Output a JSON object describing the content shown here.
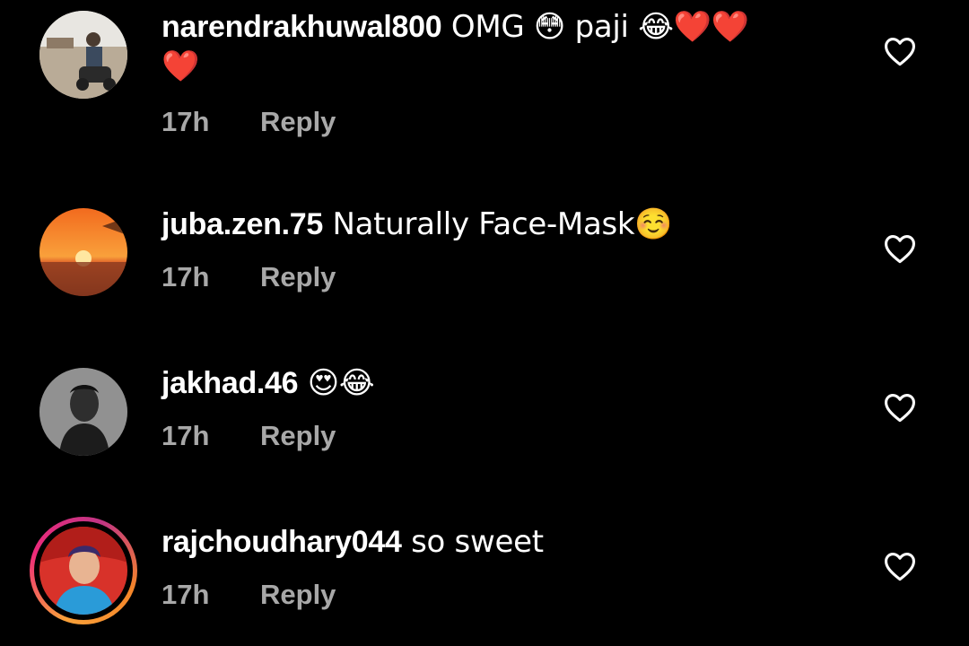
{
  "comments": [
    {
      "username": "narendrakhuwal800",
      "text": " OMG 😳 paji 😂❤️❤️",
      "text_line2": "❤️",
      "time": "17h",
      "reply_label": "Reply",
      "like_icon": "heart-outline-icon"
    },
    {
      "username": "juba.zen.75",
      "text": " Naturally Face-Mask☺️",
      "time": "17h",
      "reply_label": "Reply",
      "like_icon": "heart-outline-icon"
    },
    {
      "username": "jakhad.46",
      "text": " 😍😂",
      "time": "17h",
      "reply_label": "Reply",
      "like_icon": "heart-outline-icon"
    },
    {
      "username": "rajchoudhary044",
      "text": " so sweet",
      "time": "17h",
      "reply_label": "Reply",
      "like_icon": "heart-outline-icon"
    }
  ],
  "colors": {
    "background": "#000000",
    "text": "#ffffff",
    "meta": "#a8a8a8",
    "story_ring_start": "#f9a13a",
    "story_ring_end": "#c13584"
  }
}
